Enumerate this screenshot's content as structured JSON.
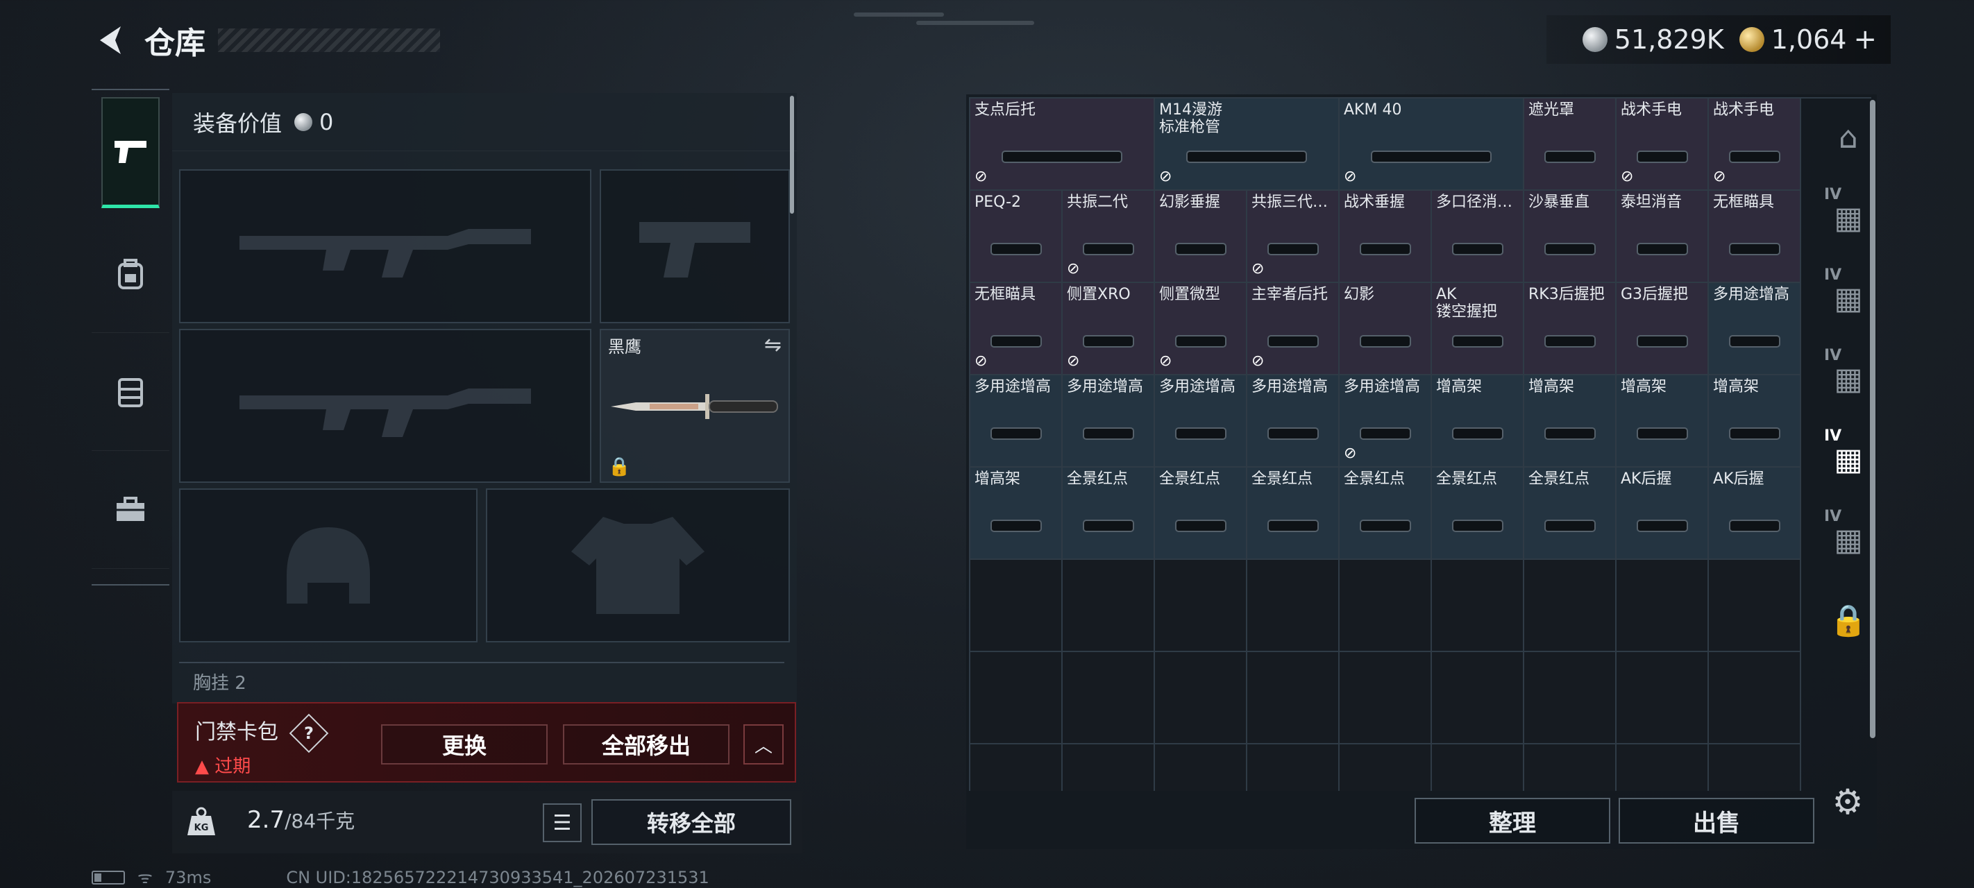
{
  "header": {
    "title": "仓库",
    "back_icon": "back-arrow-icon"
  },
  "currency": {
    "silver": "51,829K",
    "gold": "1,064",
    "plus": "+"
  },
  "left_tabs": [
    "pistol-icon",
    "backpack-icon",
    "vest-icon",
    "toolbox-icon"
  ],
  "equipment": {
    "value_label": "装备价值",
    "value": "0",
    "knife_name": "黑鹰",
    "chest_label": "胸挂 2"
  },
  "access_card": {
    "title": "门禁卡包",
    "help": "?",
    "status": "过期",
    "replace_label": "更换",
    "remove_all_label": "全部移出"
  },
  "weight": {
    "current": "2.7",
    "max": "/84千克",
    "transfer_all_label": "转移全部"
  },
  "status_bar": {
    "ping": "73ms",
    "uid": "CN UID:1825657222147309335​41_202607231531"
  },
  "stash": {
    "items": [
      {
        "name": "支点后托",
        "locked": true,
        "color": "purple",
        "span": 2
      },
      {
        "name": "M14漫游\n标准枪管",
        "locked": true,
        "color": "blue",
        "span": 2
      },
      {
        "name": "AKM 40",
        "locked": true,
        "color": "blue",
        "span": 2
      },
      {
        "name": "遮光罩",
        "locked": false,
        "color": "purple",
        "span": 1
      },
      {
        "name": "战术手电",
        "locked": true,
        "color": "purple",
        "span": 1
      },
      {
        "name": "战术手电",
        "locked": true,
        "color": "purple",
        "span": 1
      },
      {
        "name": "PEQ-2",
        "locked": false,
        "color": "purple",
        "span": 1
      },
      {
        "name": "共振二代",
        "locked": true,
        "color": "purple",
        "span": 1
      },
      {
        "name": "幻影垂握",
        "locked": false,
        "color": "purple",
        "span": 1
      },
      {
        "name": "共振三代…",
        "locked": true,
        "color": "purple",
        "span": 1
      },
      {
        "name": "战术垂握",
        "locked": false,
        "color": "purple",
        "span": 1
      },
      {
        "name": "多口径消…",
        "locked": false,
        "color": "purple",
        "span": 1
      },
      {
        "name": "沙暴垂直",
        "locked": false,
        "color": "purple",
        "span": 1
      },
      {
        "name": "泰坦消音",
        "locked": false,
        "color": "purple",
        "span": 1
      },
      {
        "name": "无框瞄具",
        "locked": false,
        "color": "purple",
        "span": 1
      },
      {
        "name": "无框瞄具",
        "locked": true,
        "color": "purple",
        "span": 1
      },
      {
        "name": "侧置XRO",
        "locked": true,
        "color": "purple",
        "span": 1
      },
      {
        "name": "侧置微型",
        "locked": true,
        "color": "purple",
        "span": 1
      },
      {
        "name": "主宰者后托",
        "locked": true,
        "color": "purple",
        "span": 1
      },
      {
        "name": "幻影",
        "locked": false,
        "color": "purple",
        "span": 1
      },
      {
        "name": "AK\n镂空握把",
        "locked": false,
        "color": "purple",
        "span": 1
      },
      {
        "name": "RK3后握把",
        "locked": false,
        "color": "purple",
        "span": 1
      },
      {
        "name": "G3后握把",
        "locked": false,
        "color": "purple",
        "span": 1
      },
      {
        "name": "多用途增高",
        "locked": false,
        "color": "blue",
        "span": 1
      },
      {
        "name": "多用途增高",
        "locked": false,
        "color": "blue",
        "span": 1
      },
      {
        "name": "多用途增高",
        "locked": false,
        "color": "blue",
        "span": 1
      },
      {
        "name": "多用途增高",
        "locked": false,
        "color": "blue",
        "span": 1
      },
      {
        "name": "多用途增高",
        "locked": false,
        "color": "blue",
        "span": 1
      },
      {
        "name": "多用途增高",
        "locked": true,
        "color": "blue",
        "span": 1
      },
      {
        "name": "增高架",
        "locked": false,
        "color": "blue",
        "span": 1
      },
      {
        "name": "增高架",
        "locked": false,
        "color": "blue",
        "span": 1
      },
      {
        "name": "增高架",
        "locked": false,
        "color": "blue",
        "span": 1
      },
      {
        "name": "增高架",
        "locked": false,
        "color": "blue",
        "span": 1
      },
      {
        "name": "增高架",
        "locked": false,
        "color": "blue",
        "span": 1
      },
      {
        "name": "全景红点",
        "locked": false,
        "color": "blue",
        "span": 1
      },
      {
        "name": "全景红点",
        "locked": false,
        "color": "blue",
        "span": 1
      },
      {
        "name": "全景红点",
        "locked": false,
        "color": "blue",
        "span": 1
      },
      {
        "name": "全景红点",
        "locked": false,
        "color": "blue",
        "span": 1
      },
      {
        "name": "全景红点",
        "locked": false,
        "color": "blue",
        "span": 1
      },
      {
        "name": "全景红点",
        "locked": false,
        "color": "blue",
        "span": 1
      },
      {
        "name": "AK后握",
        "locked": false,
        "color": "blue",
        "span": 1
      },
      {
        "name": "AK后握",
        "locked": false,
        "color": "blue",
        "span": 1
      }
    ],
    "empty_cells": 27,
    "organize_label": "整理",
    "sell_label": "出售"
  },
  "right_tabs": [
    {
      "icon": "stash-home-icon",
      "level": ""
    },
    {
      "icon": "container-icon",
      "level": "IV"
    },
    {
      "icon": "container-icon",
      "level": "IV"
    },
    {
      "icon": "container-add-icon",
      "level": "IV"
    },
    {
      "icon": "container-icon",
      "level": "IV"
    },
    {
      "icon": "container-icon",
      "level": "IV"
    },
    {
      "icon": "lock-icon",
      "level": ""
    }
  ],
  "colors": {
    "accent": "#2ee6a8",
    "danger": "#ff4b4b",
    "purple_item": "#2f2b3c",
    "blue_item": "#243441"
  }
}
